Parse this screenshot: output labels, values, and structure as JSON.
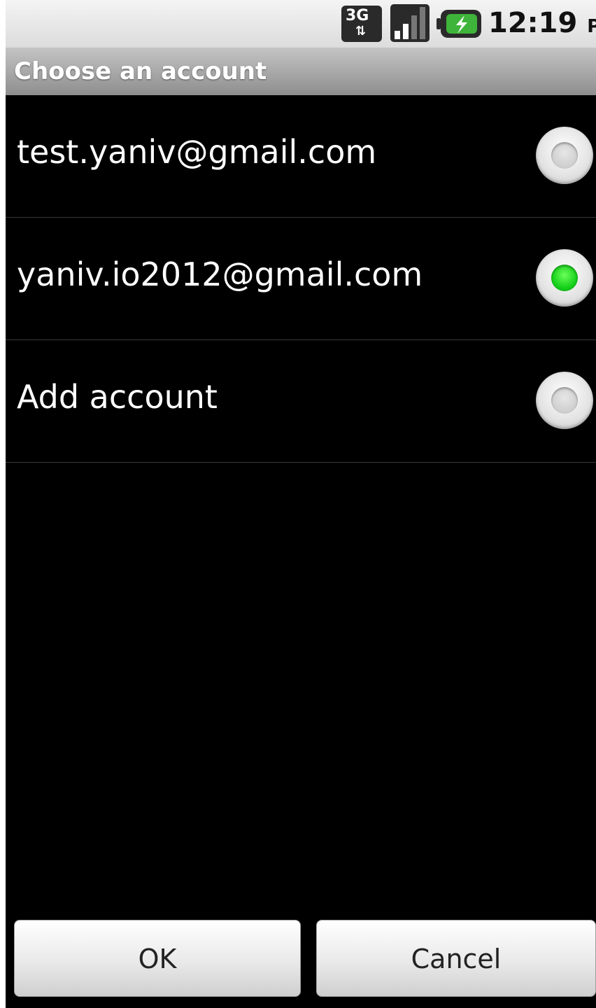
{
  "status_bar": {
    "network_type": "3G",
    "network_icon": "3g-data-icon",
    "signal_icon": "signal-strength-icon",
    "battery_icon": "battery-charging-icon",
    "time": "12:19",
    "ampm": "PM"
  },
  "dialog": {
    "title": "Choose an account",
    "options": [
      {
        "label": "test.yaniv@gmail.com",
        "selected": false
      },
      {
        "label": "yaniv.io2012@gmail.com",
        "selected": true
      },
      {
        "label": "Add account",
        "selected": false
      }
    ],
    "buttons": {
      "ok": "OK",
      "cancel": "Cancel"
    }
  },
  "colors": {
    "selected_radio": "#16d01a",
    "background": "#000000"
  }
}
